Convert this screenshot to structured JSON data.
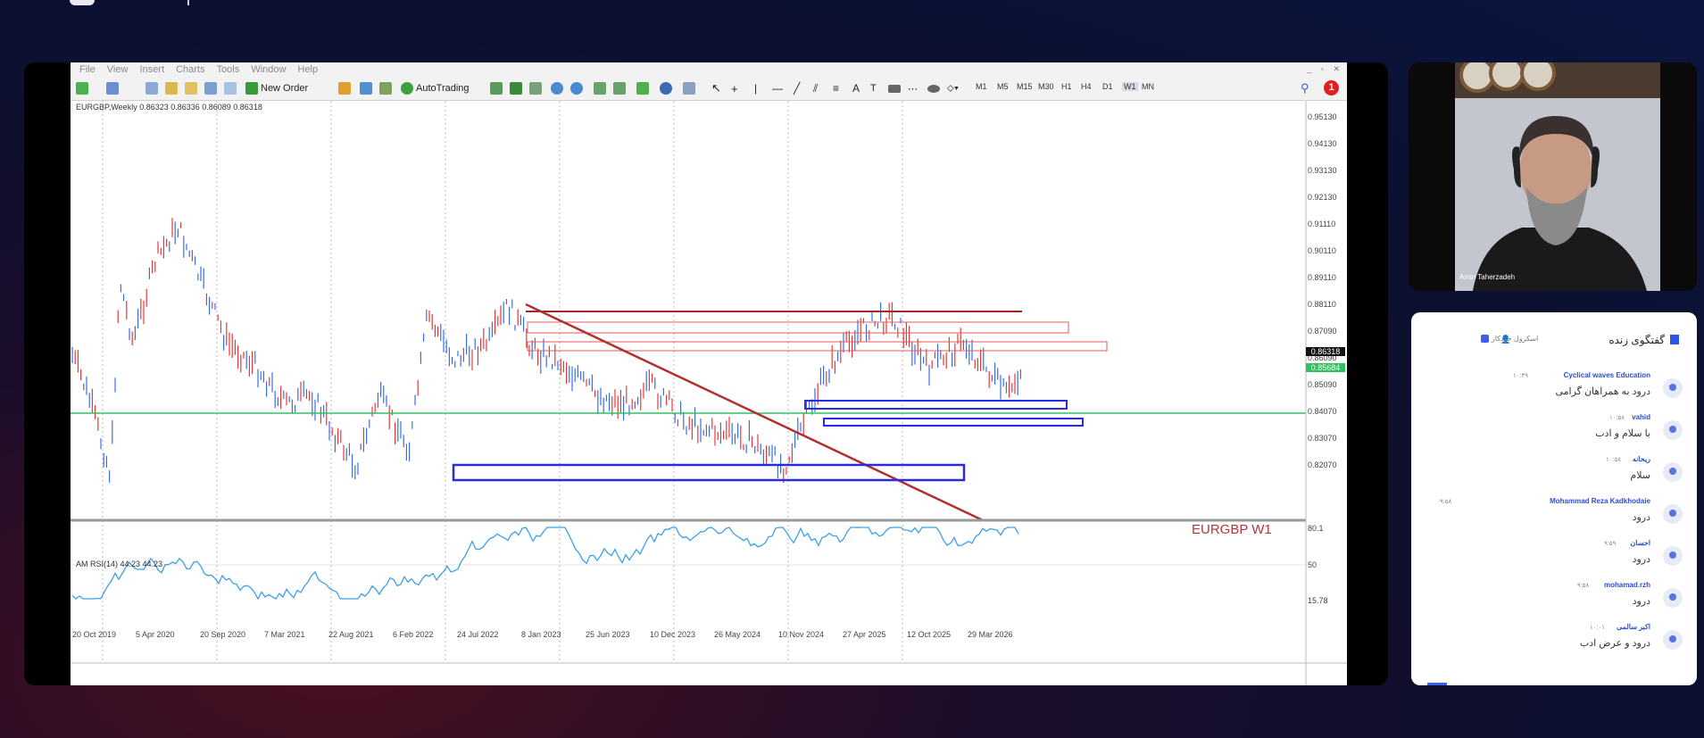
{
  "menu": [
    "File",
    "View",
    "Insert",
    "Charts",
    "Tools",
    "Window",
    "Help"
  ],
  "toolbar": {
    "new_order": "New Order",
    "autotrading": "AutoTrading",
    "timeframes": [
      "M1",
      "M5",
      "M15",
      "M30",
      "H1",
      "H4",
      "D1",
      "W1",
      "MN"
    ],
    "active_timeframe": "W1",
    "alert_count": "1"
  },
  "chart": {
    "header": "EURGBP,Weekly  0.86323 0.86336 0.86089 0.86318",
    "symbol_label": "EURGBP W1",
    "current_price": "0.86318",
    "line_price": "0.85684",
    "price_labels": [
      "0.95130",
      "0.94130",
      "0.93130",
      "0.92130",
      "0.91110",
      "0.90110",
      "0.89110",
      "0.88110",
      "0.87090",
      "0.86090",
      "0.85090",
      "0.84070",
      "0.83070",
      "0.82070"
    ],
    "date_labels": [
      "20 Oct 2019",
      "5 Apr 2020",
      "20 Sep 2020",
      "7 Mar 2021",
      "22 Aug 2021",
      "6 Feb 2022",
      "24 Jul 2022",
      "8 Jan 2023",
      "25 Jun 2023",
      "10 Dec 2023",
      "26 May 2024",
      "10 Nov 2024",
      "27 Apr 2025",
      "12 Oct 2025",
      "29 Mar 2026"
    ],
    "rsi_header": "AM  RSI(14) 44.23 44.23",
    "rsi_labels": [
      "80.1",
      "50",
      "15.78"
    ],
    "colors": {
      "up": "#e23b3b",
      "down": "#3b6ee2",
      "trendline": "#b03030",
      "zone_red": "#e65a5a",
      "zone_blue": "#2a2ae0",
      "green_line": "#30c060",
      "rsi": "#3da0e8"
    }
  },
  "webcam": {
    "presenter_name": "Amin Taherzadeh"
  },
  "chat": {
    "title": "گفتگوی زنده",
    "scroll_label": "اسکرول خودکار",
    "messages": [
      {
        "sender": "Cyclical waves Education",
        "time": "۱۰:۳۹",
        "text": "درود به همراهان گرامی"
      },
      {
        "sender": "vahid",
        "time": "۱۰:۵۸",
        "text": "با سلام و ادب"
      },
      {
        "sender": "ریحانه",
        "time": "۱۰:۵۸",
        "text": "سلام"
      },
      {
        "sender": "Mohammad Reza Kadkhodaie",
        "time": "۹:۵۸",
        "text": "درود"
      },
      {
        "sender": "احسان",
        "time": "۹:۵۹",
        "text": "درود"
      },
      {
        "sender": "mohamad.rzh",
        "time": "۹:۵۸",
        "text": "درود"
      },
      {
        "sender": "اکبر سالمی",
        "time": "۱۰:۰۱",
        "text": "درود و عرض ادب"
      }
    ]
  }
}
